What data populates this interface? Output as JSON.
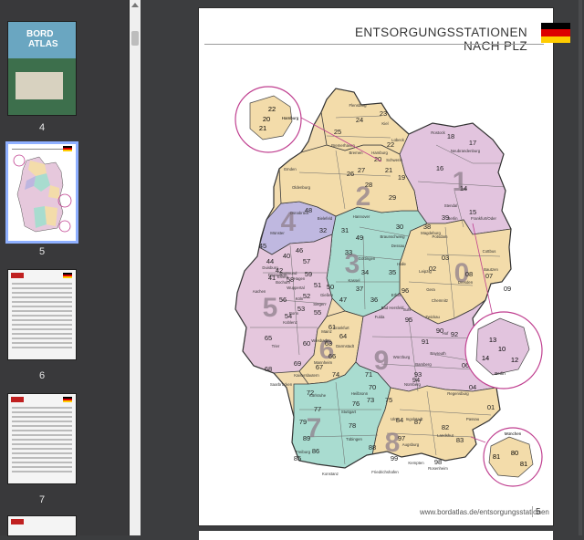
{
  "sidebar": {
    "thumbnails": [
      {
        "page_label": "4",
        "cover_title": "BORD",
        "cover_subtitle": "ATLAS"
      },
      {
        "page_label": "5"
      },
      {
        "page_label": "6"
      },
      {
        "page_label": "7"
      }
    ]
  },
  "page": {
    "title": "ENTSORGUNGSSTATIONEN NACH PLZ",
    "footer_url": "www.bordatlas.de/entsorgungsstationen",
    "page_number": "5",
    "flag_colors": [
      "#000000",
      "#dd0000",
      "#ffcc00"
    ],
    "inset_hamburg": {
      "label": "Hamburg",
      "zones": [
        "22",
        "20",
        "21"
      ]
    },
    "inset_berlin": {
      "label": "Berlin",
      "zones": [
        "13",
        "10",
        "14",
        "12"
      ]
    },
    "inset_muenchen": {
      "label": "München",
      "zones": [
        "81",
        "80",
        "81"
      ]
    },
    "regions": [
      "0",
      "1",
      "2",
      "3",
      "4",
      "5",
      "6",
      "7",
      "8",
      "9"
    ],
    "zones": [
      "24",
      "23",
      "25",
      "22",
      "20",
      "21",
      "27",
      "28",
      "26",
      "29",
      "19",
      "18",
      "17",
      "16",
      "14",
      "15",
      "39",
      "38",
      "30",
      "31",
      "49",
      "48",
      "32",
      "33",
      "34",
      "37",
      "35",
      "36",
      "47",
      "46",
      "45",
      "44",
      "40",
      "41",
      "42",
      "58",
      "59",
      "57",
      "50",
      "51",
      "52",
      "53",
      "56",
      "54",
      "55",
      "65",
      "60",
      "61",
      "63",
      "64",
      "66",
      "67",
      "68",
      "69",
      "74",
      "71",
      "70",
      "73",
      "76",
      "75",
      "72",
      "77",
      "78",
      "79",
      "89",
      "86",
      "85",
      "84",
      "87",
      "82",
      "83",
      "88",
      "99",
      "98",
      "97",
      "96",
      "95",
      "91",
      "90",
      "92",
      "93",
      "94",
      "06",
      "04",
      "01",
      "03",
      "02",
      "07",
      "08",
      "09"
    ],
    "cities": [
      "Flensburg",
      "Kiel",
      "Lübeck",
      "Schwerin",
      "Neubrandenburg",
      "Rostock",
      "Bremen",
      "Hamburg",
      "Emden",
      "Oldenburg",
      "Bremerhaven",
      "Osnabrück",
      "Münster",
      "Hannover",
      "Bielefeld",
      "Braunschweig",
      "Magdeburg",
      "Stendal",
      "Potsdam",
      "Berlin",
      "Frankfurt/Oder",
      "Cottbus",
      "Dessau",
      "Halle",
      "Leipzig",
      "Dresden",
      "Bautzen",
      "Gera",
      "Chemnitz",
      "Zwickau",
      "Erfurt",
      "Göttingen",
      "Kassel",
      "Fulda",
      "Gießen",
      "Siegen",
      "Köln",
      "Bonn",
      "Koblenz",
      "Trier",
      "Aachen",
      "Düsseldorf",
      "Duisburg",
      "Dortmund",
      "Bochum",
      "Essen",
      "Wuppertal",
      "Hagen",
      "Mainz",
      "Wiesbaden",
      "Frankfurt",
      "Darmstadt",
      "Mannheim",
      "Kaiserslautern",
      "Saarbrücken",
      "Karlsruhe",
      "Stuttgart",
      "Heilbronn",
      "Tübingen",
      "Ulm",
      "Freiburg",
      "Konstanz",
      "Würzburg",
      "Nürnberg",
      "Bayreuth",
      "Hof",
      "Bamberg",
      "Regensburg",
      "Passau",
      "Landshut",
      "Augsburg",
      "Kempten",
      "Ingolstadt",
      "Rosenheim",
      "Friedrichshafen",
      "Bad Hersfeld",
      "Suhl"
    ]
  }
}
